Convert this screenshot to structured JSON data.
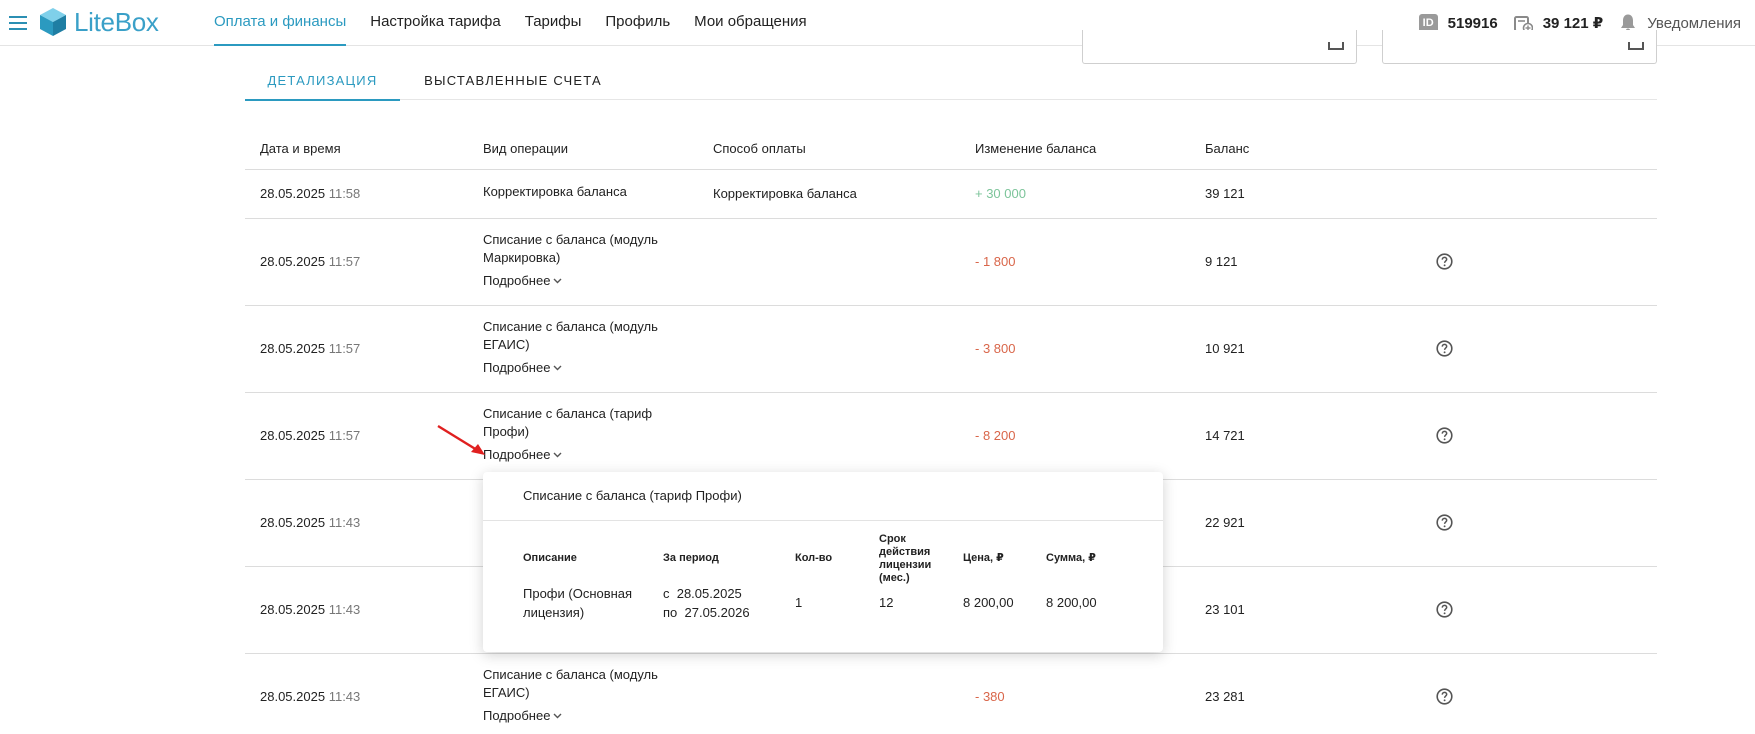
{
  "header": {
    "logo_text": "LiteBox",
    "nav": [
      {
        "label": "Оплата и финансы",
        "active": true
      },
      {
        "label": "Настройка тарифа",
        "active": false
      },
      {
        "label": "Тарифы",
        "active": false
      },
      {
        "label": "Профиль",
        "active": false
      },
      {
        "label": "Мои обращения",
        "active": false
      }
    ],
    "id_label": "ID",
    "account_id": "519916",
    "balance": "39 121 ₽",
    "notifications_label": "Уведомления",
    "accent_color": "#2b9ac0"
  },
  "tabs": [
    {
      "label": "ДЕТАЛИЗАЦИЯ",
      "active": true
    },
    {
      "label": "ВЫСТАВЛЕННЫЕ СЧЕТА",
      "active": false
    }
  ],
  "table": {
    "columns": [
      "Дата и время",
      "Вид операции",
      "Способ оплаты",
      "Изменение баланса",
      "Баланс"
    ],
    "more_label": "Подробнее",
    "rows": [
      {
        "date": "28.05.2025",
        "time": "11:58",
        "operation": "Корректировка баланса",
        "payment": "Корректировка баланса",
        "change": "+ 30 000",
        "balance": "39 121",
        "sign": "positive"
      },
      {
        "date": "28.05.2025",
        "time": "11:57",
        "operation": "Списание с баланса (модуль Маркировка)",
        "payment": "",
        "change": "- 1 800",
        "balance": "9 121",
        "sign": "negative"
      },
      {
        "date": "28.05.2025",
        "time": "11:57",
        "operation": "Списание с баланса (модуль ЕГАИС)",
        "payment": "",
        "change": "- 3 800",
        "balance": "10 921",
        "sign": "negative"
      },
      {
        "date": "28.05.2025",
        "time": "11:57",
        "operation": "Списание с баланса (тариф Профи)",
        "payment": "",
        "change": "- 8 200",
        "balance": "14 721",
        "sign": "negative"
      },
      {
        "date": "28.05.2025",
        "time": "11:43",
        "operation": "",
        "payment": "",
        "change": "",
        "balance": "22 921",
        "sign": "negative"
      },
      {
        "date": "28.05.2025",
        "time": "11:43",
        "operation": "",
        "payment": "",
        "change": "",
        "balance": "23 101",
        "sign": "negative"
      },
      {
        "date": "28.05.2025",
        "time": "11:43",
        "operation": "Списание с баланса (модуль ЕГАИС)",
        "payment": "",
        "change": "- 380",
        "balance": "23 281",
        "sign": "negative"
      }
    ]
  },
  "popup": {
    "title": "Списание с баланса (тариф Профи)",
    "columns": {
      "description": "Описание",
      "period": "За период",
      "qty": "Кол-во",
      "term": "Срок действия лицензии (мес.)",
      "price": "Цена, ₽",
      "sum": "Сумма, ₽"
    },
    "item": {
      "description": "Профи (Основная лицензия)",
      "period_from": "с  28.05.2025",
      "period_to": "по  27.05.2026",
      "qty": "1",
      "term": "12",
      "price": "8 200,00",
      "sum": "8 200,00"
    }
  },
  "colors": {
    "positive": "#7cc49a",
    "negative": "#d9664a",
    "annotation_arrow": "#e02020"
  },
  "icons": [
    "menu-icon",
    "litebox-logo-icon",
    "wallet-icon",
    "bell-icon",
    "calendar-icon",
    "chevron-down-icon",
    "help-icon",
    "annotation-arrow"
  ]
}
